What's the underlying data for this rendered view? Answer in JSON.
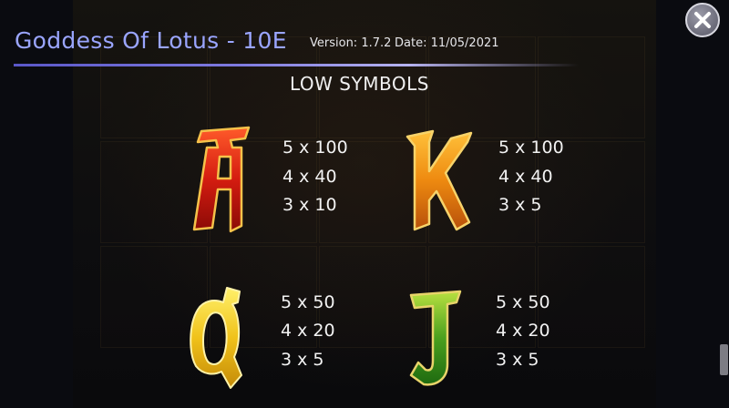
{
  "header": {
    "title": "Goddess Of Lotus - 10E",
    "version": "Version: 1.7.2",
    "date": "Date: 11/05/2021"
  },
  "section_title": "LOW SYMBOLS",
  "close_icon": "close-icon",
  "symbols": [
    {
      "glyph": "A",
      "color": "#c81e10",
      "payouts": [
        "5 x 100",
        "4 x 40",
        "3 x 10"
      ]
    },
    {
      "glyph": "K",
      "color": "#e07a10",
      "payouts": [
        "5 x 100",
        "4 x 40",
        "3 x 5"
      ]
    },
    {
      "glyph": "Q",
      "color": "#e8b818",
      "payouts": [
        "5 x 50",
        "4 x 20",
        "3 x 5"
      ]
    },
    {
      "glyph": "J",
      "color": "#3a9a1a",
      "payouts": [
        "5 x 50",
        "4 x 20",
        "3 x 5"
      ]
    }
  ]
}
